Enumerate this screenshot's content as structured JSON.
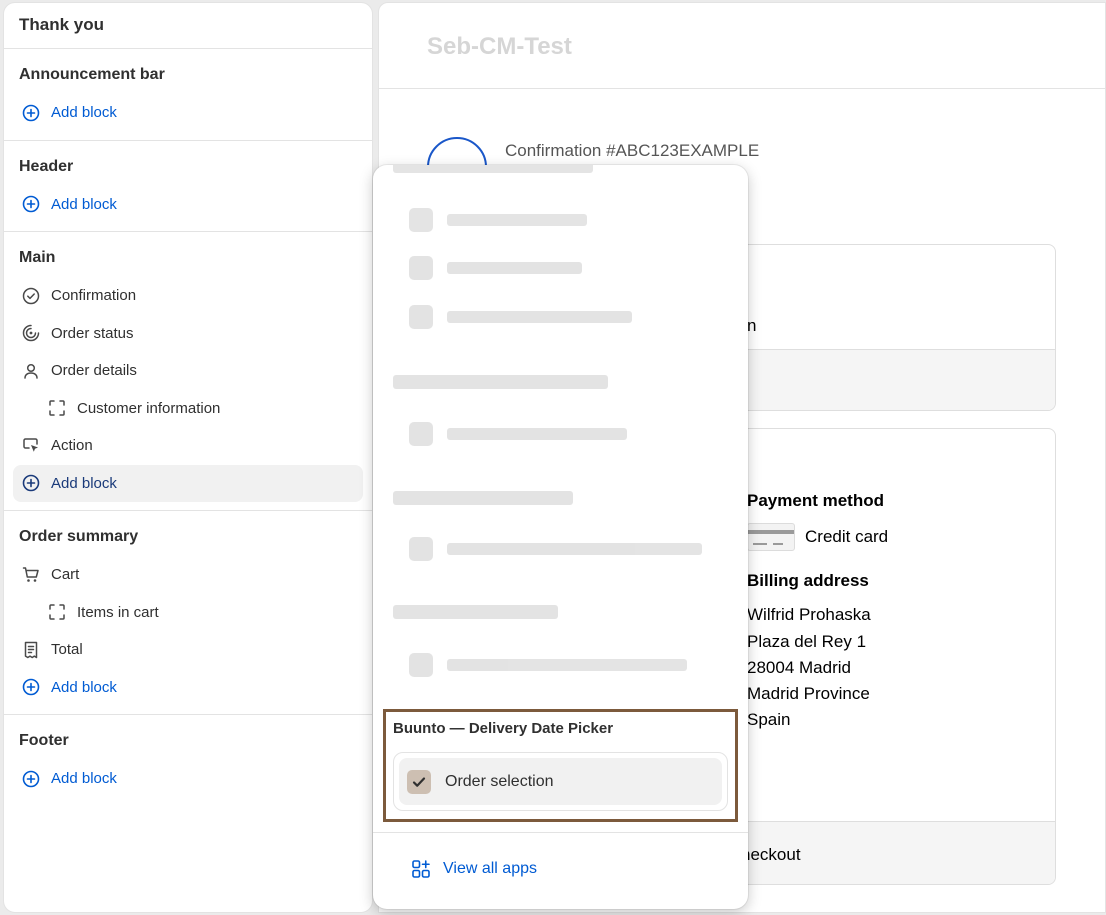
{
  "sidebar": {
    "title": "Thank you",
    "sections": {
      "announcement": {
        "heading": "Announcement bar",
        "add": "Add block"
      },
      "header": {
        "heading": "Header",
        "add": "Add block"
      },
      "main": {
        "heading": "Main",
        "items": [
          "Confirmation",
          "Order status",
          "Order details",
          "Customer information",
          "Action"
        ],
        "add": "Add block"
      },
      "summary": {
        "heading": "Order summary",
        "items": [
          "Cart",
          "Items in cart",
          "Total"
        ],
        "add": "Add block"
      },
      "footer": {
        "heading": "Footer",
        "add": "Add block"
      }
    }
  },
  "preview": {
    "store_name": "Seb-CM-Test",
    "confirmation": "Confirmation #ABC123EXAMPLE",
    "card1_fragment": "n",
    "payment_heading": "Payment method",
    "payment_value": "Credit card",
    "billing_heading": "Billing address",
    "billing_lines": [
      "Wilfrid Prohaska",
      "Plaza del Rey 1",
      "28004 Madrid",
      "Madrid Province",
      "Spain"
    ],
    "checkout_fragment": "heckout"
  },
  "popover": {
    "app_name": "Buunto — Delivery Date Picker",
    "order_selection": "Order selection",
    "view_all": "View all apps"
  },
  "colors": {
    "accent": "#005bd3",
    "highlight_border": "#7c5a3c",
    "checkbox": "#cdbfb2"
  }
}
